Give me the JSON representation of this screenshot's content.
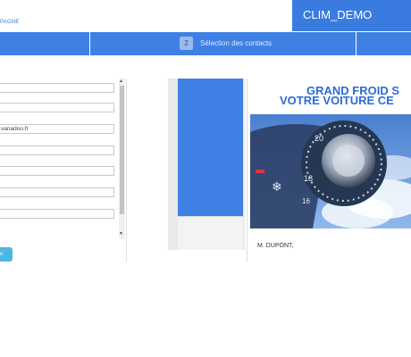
{
  "header": {
    "left_text": "PAGNE",
    "app_title": "CLIM_DEMO",
    "accent_color": "#3a7be0"
  },
  "steps": {
    "current_number": "2",
    "current_label": "Sélection des contacts"
  },
  "form": {
    "fields": [
      "",
      "",
      "vanadoo.fr",
      "",
      "",
      "",
      ""
    ],
    "button_label": "u"
  },
  "preview": {
    "headline_line1": "GRAND FROID S",
    "headline_line2": "VOTRE VOITURE CE",
    "image_icon": "car-ac-dial-image",
    "salutation": "M. DUPONT,"
  }
}
